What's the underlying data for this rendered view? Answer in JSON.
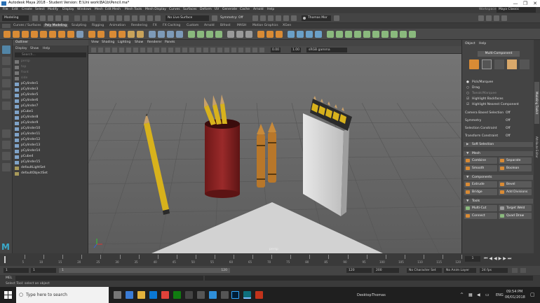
{
  "window": {
    "title": "Autodesk Maya 2018 - Student Version: E:\\Uni work\\BA1b\\Pencil.ma*",
    "controls": [
      "—",
      "❐",
      "✕"
    ]
  },
  "menubar": {
    "items": [
      "File",
      "Edit",
      "Create",
      "Select",
      "Modify",
      "Display",
      "Windows",
      "Mesh",
      "Edit Mesh",
      "Mesh Tools",
      "Mesh Display",
      "Curves",
      "Surfaces",
      "Deform",
      "UV",
      "Generate",
      "Cache",
      "Arnold",
      "Help"
    ],
    "workspace_label": "Workspace:",
    "workspace_value": "Maya Classic"
  },
  "statusline": {
    "mode": "Modeling",
    "live_surface": "No Live Surface",
    "symmetry": "Symmetry: Off",
    "user": "Thomas Mor"
  },
  "shelf": {
    "tabs": [
      "Curves / Surfaces",
      "Poly Modeling",
      "Sculpting",
      "Rigging",
      "Animation",
      "Rendering",
      "FX",
      "FX Caching",
      "Custom",
      "Arnold",
      "Bifrost",
      "MASH",
      "Motion Graphics",
      "XGen"
    ],
    "active_tab": "Poly Modeling"
  },
  "outliner": {
    "title": "Outliner",
    "menu": [
      "Display",
      "Show",
      "Help"
    ],
    "search_placeholder": "Search...",
    "items": [
      {
        "label": "persp",
        "dim": true
      },
      {
        "label": "top",
        "dim": true
      },
      {
        "label": "front",
        "dim": true
      },
      {
        "label": "side",
        "dim": true
      },
      {
        "label": "pCylinder1",
        "dim": false
      },
      {
        "label": "pCylinder3",
        "dim": false
      },
      {
        "label": "pCylinder5",
        "dim": false
      },
      {
        "label": "pCylinder6",
        "dim": false
      },
      {
        "label": "pCylinder7",
        "dim": false
      },
      {
        "label": "pCube1",
        "dim": false
      },
      {
        "label": "pCylinder8",
        "dim": false
      },
      {
        "label": "pCylinder9",
        "dim": false
      },
      {
        "label": "pCylinder10",
        "dim": false
      },
      {
        "label": "pCylinder11",
        "dim": false
      },
      {
        "label": "pCylinder12",
        "dim": false
      },
      {
        "label": "pCylinder13",
        "dim": false
      },
      {
        "label": "pCylinder14",
        "dim": false
      },
      {
        "label": "pCube4",
        "dim": false
      },
      {
        "label": "pCylinder15",
        "dim": false
      },
      {
        "label": "defaultLightSet",
        "dim": false
      },
      {
        "label": "defaultObjectSet",
        "dim": false
      }
    ]
  },
  "viewport": {
    "menu": [
      "View",
      "Shading",
      "Lighting",
      "Show",
      "Renderer",
      "Panels"
    ],
    "near_value": "0.00",
    "scale_value": "1.00",
    "color_space": "sRGB gamma",
    "camera_label": "persp"
  },
  "panel": {
    "menu": [
      "Object",
      "Help"
    ],
    "mode_button": "Multi-Component",
    "options": [
      {
        "label": "Pick/Marquee",
        "kind": "radio",
        "on": true
      },
      {
        "label": "Drag",
        "kind": "radio",
        "on": false
      },
      {
        "label": "Tweak/Marquee",
        "kind": "radio",
        "on": false
      },
      {
        "label": "Highlight Backfaces",
        "kind": "check",
        "on": true
      },
      {
        "label": "Highlight Nearest Component",
        "kind": "check",
        "on": true
      }
    ],
    "settings": [
      {
        "label": "Camera Based Selection",
        "value": "Off"
      },
      {
        "label": "Symmetry",
        "value": "Off"
      },
      {
        "label": "Selection Constraint",
        "value": "Off"
      },
      {
        "label": "Transform Constraint",
        "value": "Off"
      }
    ],
    "soft_selection": "Soft Selection",
    "sections": {
      "mesh": "Mesh",
      "components": "Components",
      "tools": "Tools"
    },
    "mesh_buttons": [
      "Combine",
      "Separate",
      "Smooth",
      "Boolean"
    ],
    "component_buttons": [
      "Extrude",
      "Bevel",
      "Bridge",
      "Add Divisions"
    ],
    "tool_buttons": [
      "Multi-Cut",
      "Target Weld",
      "Connect",
      "Quad Draw"
    ],
    "side_tabs": [
      "Modeling Toolkit",
      "Attribute Editor"
    ]
  },
  "timeline": {
    "ticks": [
      "5",
      "10",
      "15",
      "20",
      "25",
      "30",
      "35",
      "40",
      "45",
      "50",
      "55",
      "60",
      "65",
      "70",
      "75",
      "80",
      "85",
      "90",
      "95",
      "100",
      "105",
      "110",
      "115",
      "120"
    ],
    "current_frame": "1"
  },
  "range": {
    "start": "1",
    "start2": "1",
    "slider_start": "1",
    "slider_end": "120",
    "end": "120",
    "end2": "200",
    "character_set": "No Character Set",
    "anim_layer": "No Anim Layer",
    "fps": "24 fps"
  },
  "cmdline": {
    "label": "MEL"
  },
  "helpline": {
    "text": "Select Tool: select an object"
  },
  "taskbar": {
    "search_placeholder": "Type here to search",
    "desktop_label": "Desktop",
    "user_label": "Thomas",
    "language": "ENG",
    "time": "09:54 PM",
    "date": "06/01/2018"
  },
  "colors": {
    "maya_orange": "#d98b35",
    "red_cup": "#8a2222",
    "crayon": "#b8772a",
    "pencil_yellow": "#d8b21c",
    "active_blue": "#5285a6"
  }
}
